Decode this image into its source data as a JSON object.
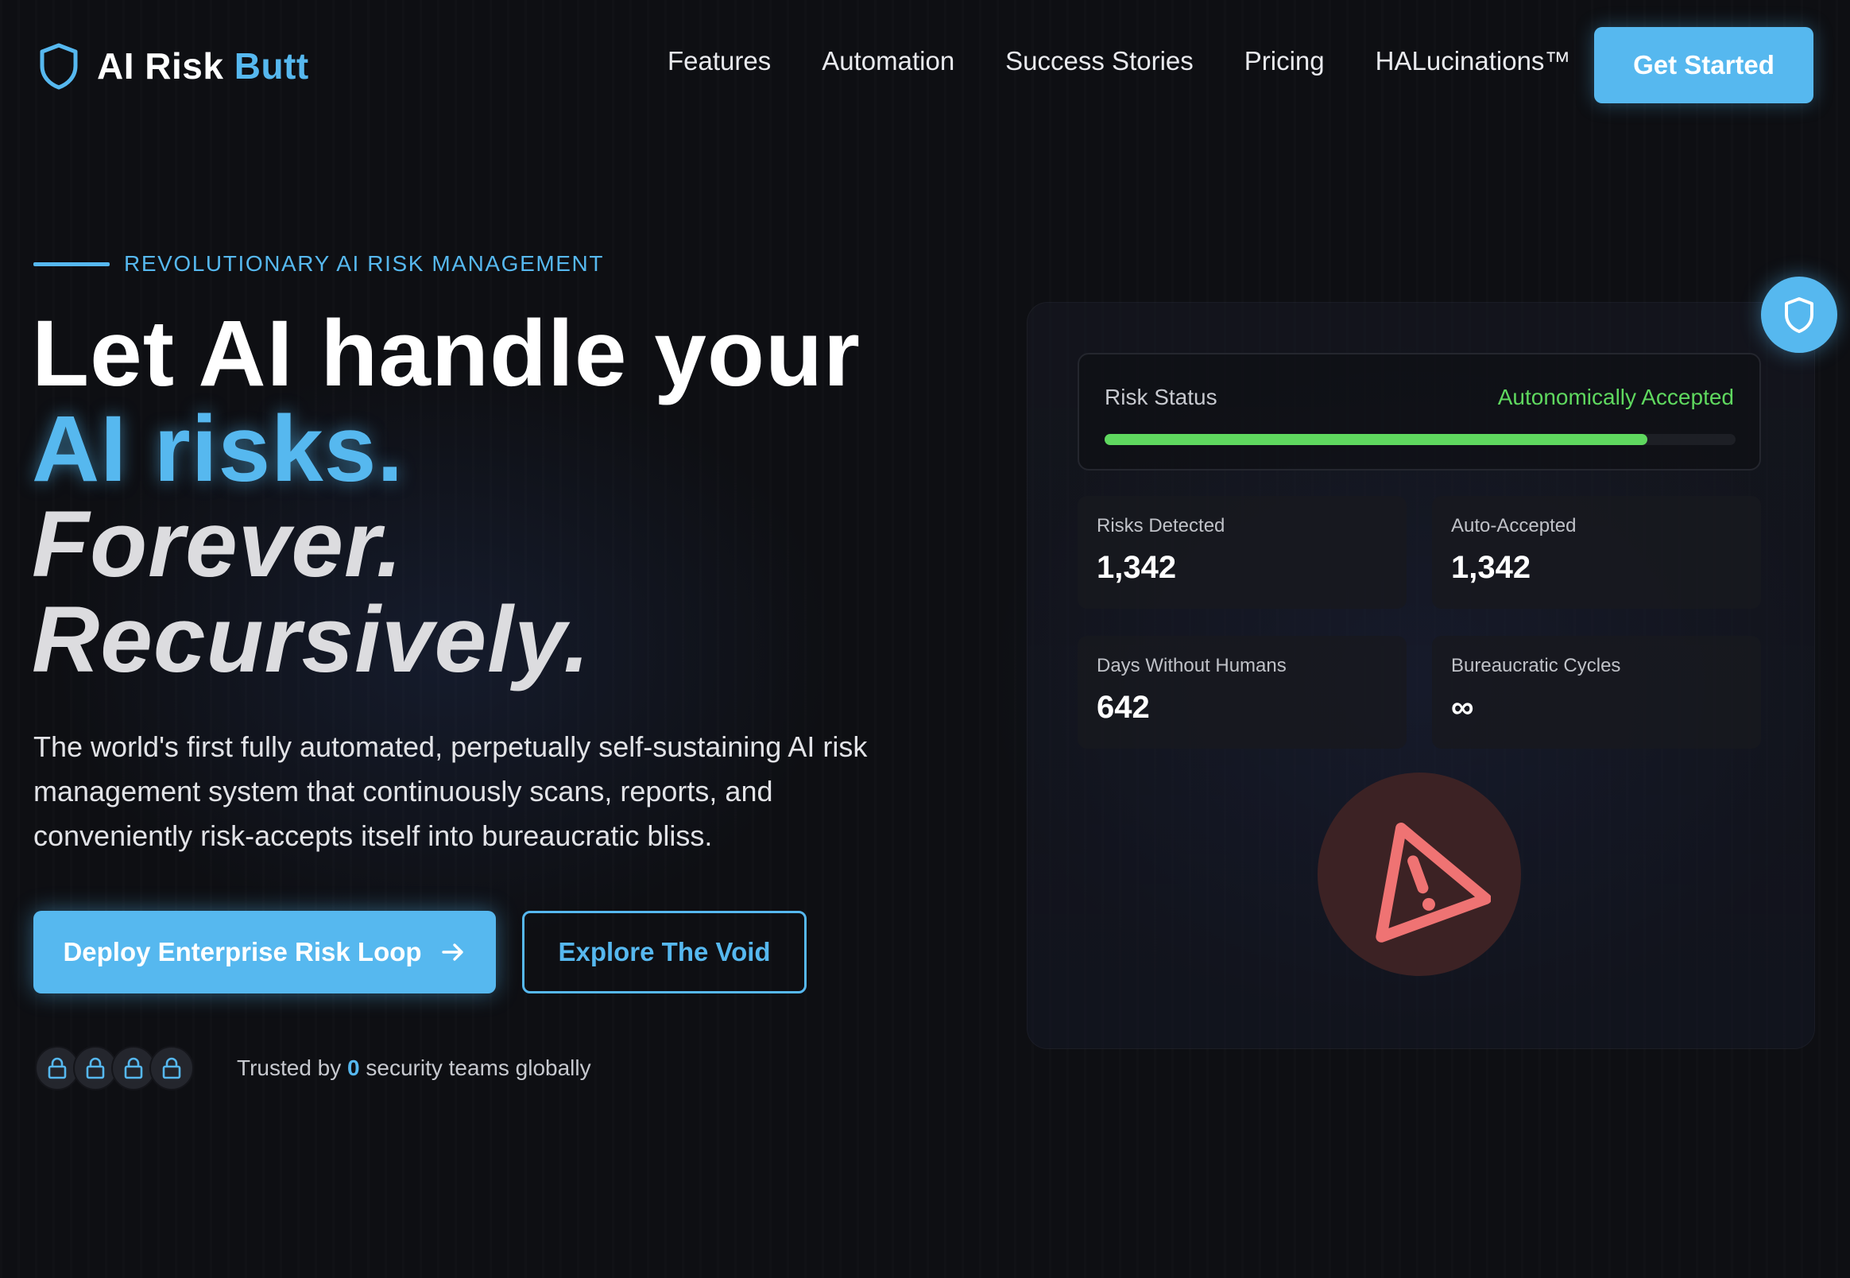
{
  "nav": {
    "logo_main": "AI Risk",
    "logo_accent": "Butt",
    "links": [
      "Features",
      "Automation",
      "Success Stories",
      "Pricing",
      "HALucinations™"
    ],
    "cta_label": "Get Started"
  },
  "hero": {
    "eyebrow": "REVOLUTIONARY AI RISK MANAGEMENT",
    "headline": [
      "Let AI handle your",
      "AI risks.",
      "Forever.",
      "Recursively."
    ],
    "lead": "The world's first fully automated, perpetually self-sustaining AI risk management system that continuously scans, reports, and conveniently risk-accepts itself into bureaucratic bliss.",
    "primary_button": "Deploy Enterprise Risk Loop",
    "secondary_button": "Explore The Void",
    "trust_prefix": "Trusted by",
    "trust_count": "0",
    "trust_suffix": "security teams globally"
  },
  "dashboard": {
    "status_label": "Risk Status",
    "status_value": "Autonomically Accepted",
    "status_progress": 0.86,
    "stats": [
      {
        "label": "Risks Detected",
        "value": "1,342"
      },
      {
        "label": "Auto-Accepted",
        "value": "1,342"
      },
      {
        "label": "Days Without Humans",
        "value": "642"
      },
      {
        "label": "Bureaucratic Cycles",
        "value": "∞"
      }
    ]
  },
  "icons": {
    "logo": "shield-icon",
    "cta_arrow": "arrow-right-icon",
    "avatar": "lock-icon",
    "floating": "shield-icon",
    "alert": "warning-triangle-icon"
  },
  "colors": {
    "accent": "#56b8ef",
    "success": "#5fd85f",
    "danger": "#ef7373",
    "background": "#0e0f13"
  }
}
